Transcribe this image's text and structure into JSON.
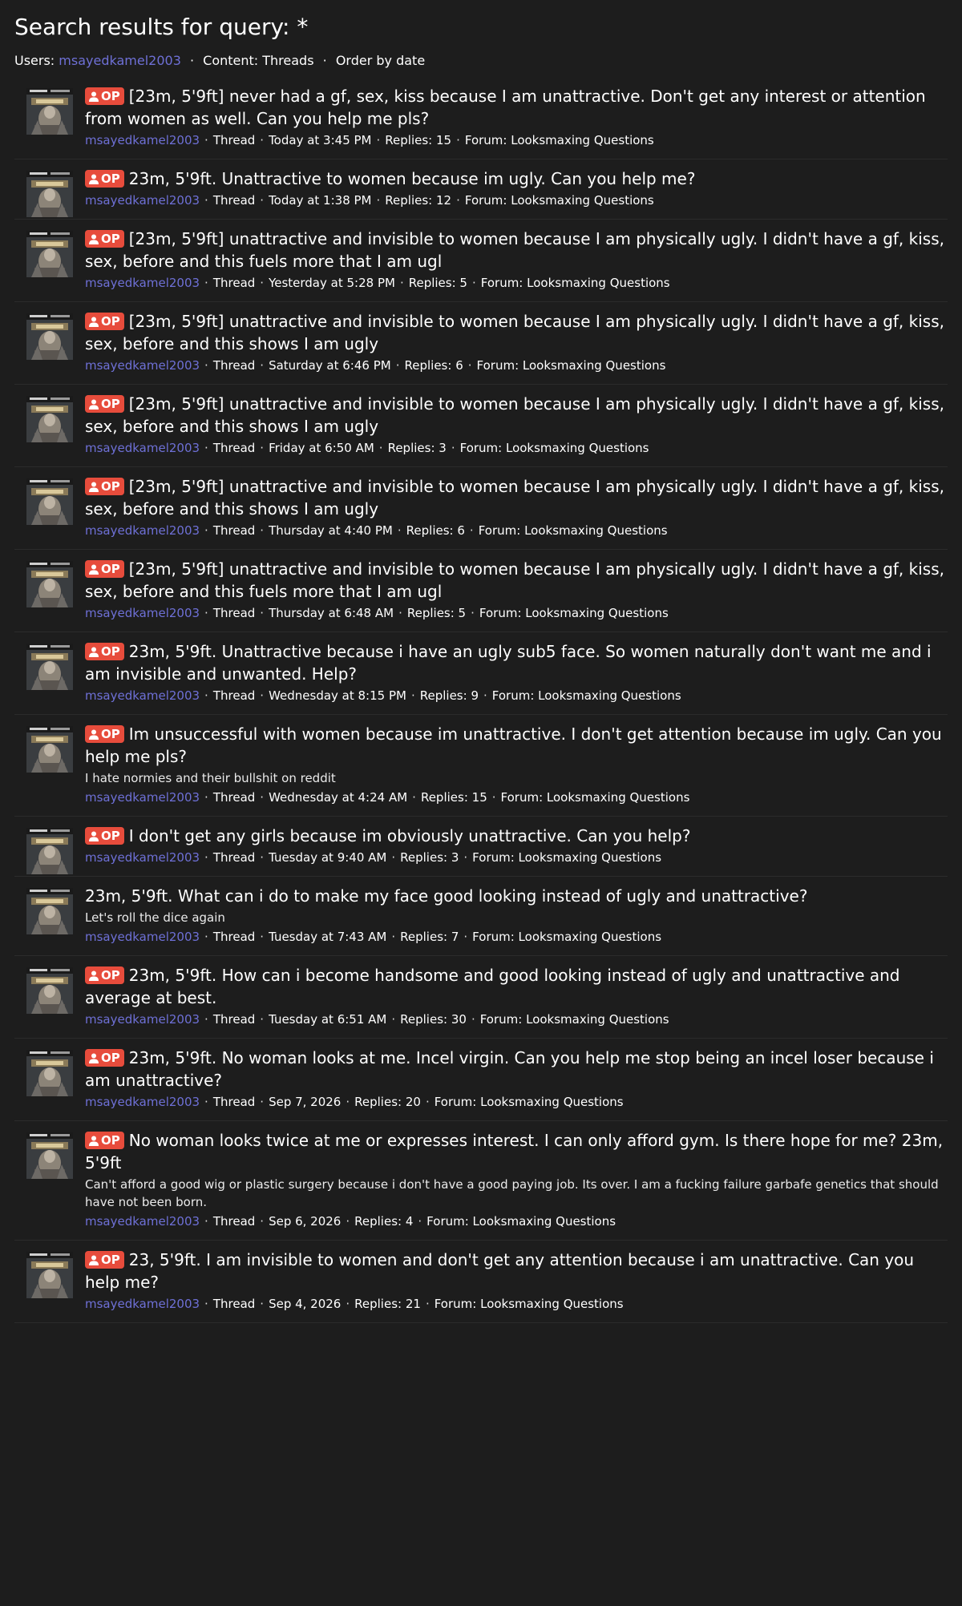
{
  "header": {
    "title": "Search results for query: *",
    "users_label": "Users:",
    "user": "msayedkamel2003",
    "content": "Content: Threads",
    "order": "Order by date"
  },
  "labels": {
    "op_badge": "OP",
    "type": "Thread",
    "forum_prefix": "Forum: "
  },
  "results": [
    {
      "title": "[23m, 5'9ft] never had a gf, sex, kiss because I am unattractive. Don't get any interest or attention from women as well. Can you help me pls?",
      "op": true,
      "snippet": "",
      "author": "msayedkamel2003",
      "date": "Today at 3:45 PM",
      "replies": "Replies: 15",
      "forum": "Forum: Looksmaxing Questions"
    },
    {
      "title": "23m, 5'9ft. Unattractive to women because im ugly. Can you help me?",
      "op": true,
      "snippet": "",
      "author": "msayedkamel2003",
      "date": "Today at 1:38 PM",
      "replies": "Replies: 12",
      "forum": "Forum: Looksmaxing Questions"
    },
    {
      "title": "[23m, 5'9ft] unattractive and invisible to women because I am physically ugly. I didn't have a gf, kiss, sex, before and this fuels more that I am ugl",
      "op": true,
      "snippet": "",
      "author": "msayedkamel2003",
      "date": "Yesterday at 5:28 PM",
      "replies": "Replies: 5",
      "forum": "Forum: Looksmaxing Questions"
    },
    {
      "title": "[23m, 5'9ft] unattractive and invisible to women because I am physically ugly. I didn't have a gf, kiss, sex, before and this shows I am ugly",
      "op": true,
      "snippet": "",
      "author": "msayedkamel2003",
      "date": "Saturday at 6:46 PM",
      "replies": "Replies: 6",
      "forum": "Forum: Looksmaxing Questions"
    },
    {
      "title": "[23m, 5'9ft] unattractive and invisible to women because I am physically ugly. I didn't have a gf, kiss, sex, before and this shows I am ugly",
      "op": true,
      "snippet": "",
      "author": "msayedkamel2003",
      "date": "Friday at 6:50 AM",
      "replies": "Replies: 3",
      "forum": "Forum: Looksmaxing Questions"
    },
    {
      "title": "[23m, 5'9ft] unattractive and invisible to women because I am physically ugly. I didn't have a gf, kiss, sex, before and this shows I am ugly",
      "op": true,
      "snippet": "",
      "author": "msayedkamel2003",
      "date": "Thursday at 4:40 PM",
      "replies": "Replies: 6",
      "forum": "Forum: Looksmaxing Questions"
    },
    {
      "title": "[23m, 5'9ft] unattractive and invisible to women because I am physically ugly. I didn't have a gf, kiss, sex, before and this fuels more that I am ugl",
      "op": true,
      "snippet": "",
      "author": "msayedkamel2003",
      "date": "Thursday at 6:48 AM",
      "replies": "Replies: 5",
      "forum": "Forum: Looksmaxing Questions"
    },
    {
      "title": "23m, 5'9ft. Unattractive because i have an ugly sub5 face. So women naturally don't want me and i am invisible and unwanted. Help?",
      "op": true,
      "snippet": "",
      "author": "msayedkamel2003",
      "date": "Wednesday at 8:15 PM",
      "replies": "Replies: 9",
      "forum": "Forum: Looksmaxing Questions"
    },
    {
      "title": "Im unsuccessful with women because im unattractive. I don't get attention because im ugly. Can you help me pls?",
      "op": true,
      "snippet": "I hate normies and their bullshit on reddit",
      "author": "msayedkamel2003",
      "date": "Wednesday at 4:24 AM",
      "replies": "Replies: 15",
      "forum": "Forum: Looksmaxing Questions"
    },
    {
      "title": "I don't get any girls because im obviously unattractive. Can you help?",
      "op": true,
      "snippet": "",
      "author": "msayedkamel2003",
      "date": "Tuesday at 9:40 AM",
      "replies": "Replies: 3",
      "forum": "Forum: Looksmaxing Questions"
    },
    {
      "title": "23m, 5'9ft. What can i do to make my face good looking instead of ugly and unattractive?",
      "op": false,
      "snippet": "Let's roll the dice again",
      "author": "msayedkamel2003",
      "date": "Tuesday at 7:43 AM",
      "replies": "Replies: 7",
      "forum": "Forum: Looksmaxing Questions"
    },
    {
      "title": "23m, 5'9ft. How can i become handsome and good looking instead of ugly and unattractive and average at best.",
      "op": true,
      "snippet": "",
      "author": "msayedkamel2003",
      "date": "Tuesday at 6:51 AM",
      "replies": "Replies: 30",
      "forum": "Forum: Looksmaxing Questions"
    },
    {
      "title": "23m, 5'9ft. No woman looks at me. Incel virgin. Can you help me stop being an incel loser because i am unattractive?",
      "op": true,
      "snippet": "",
      "author": "msayedkamel2003",
      "date": "Sep 7, 2026",
      "replies": "Replies: 20",
      "forum": "Forum: Looksmaxing Questions"
    },
    {
      "title": "No woman looks twice at me or expresses interest. I can only afford gym. Is there hope for me? 23m, 5'9ft",
      "op": true,
      "snippet": "Can't afford a good wig or plastic surgery because i don't have a good paying job. Its over. I am a fucking failure garbafe genetics that should have not been born.",
      "author": "msayedkamel2003",
      "date": "Sep 6, 2026",
      "replies": "Replies: 4",
      "forum": "Forum: Looksmaxing Questions"
    },
    {
      "title": "23, 5'9ft. I am invisible to women and don't get any attention because i am unattractive. Can you help me?",
      "op": true,
      "snippet": "",
      "author": "msayedkamel2003",
      "date": "Sep 4, 2026",
      "replies": "Replies: 21",
      "forum": "Forum: Looksmaxing Questions"
    }
  ]
}
